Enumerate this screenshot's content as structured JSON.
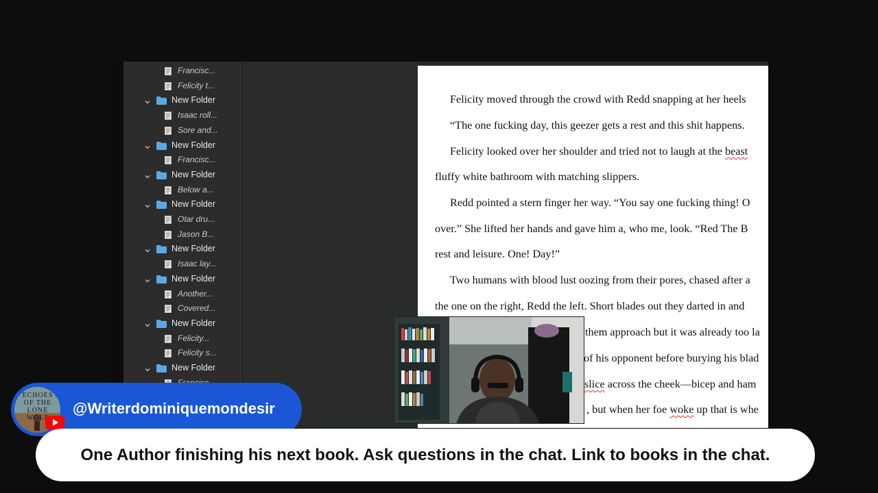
{
  "binder": {
    "items": [
      {
        "type": "doc",
        "label": "Francisc..."
      },
      {
        "type": "doc",
        "label": "Felicity t..."
      },
      {
        "type": "folder",
        "label": "New Folder"
      },
      {
        "type": "doc",
        "label": "Isaac roll..."
      },
      {
        "type": "doc",
        "label": "Sore and..."
      },
      {
        "type": "folder",
        "label": "New Folder"
      },
      {
        "type": "doc",
        "label": "Francisc..."
      },
      {
        "type": "folder",
        "label": "New Folder"
      },
      {
        "type": "doc",
        "label": "Below a..."
      },
      {
        "type": "folder",
        "label": "New Folder"
      },
      {
        "type": "doc",
        "label": "Otar dru..."
      },
      {
        "type": "doc",
        "label": "Jason B..."
      },
      {
        "type": "folder",
        "label": "New Folder"
      },
      {
        "type": "doc",
        "label": "Isaac lay..."
      },
      {
        "type": "folder",
        "label": "New Folder"
      },
      {
        "type": "doc",
        "label": "Another..."
      },
      {
        "type": "doc",
        "label": "Covered..."
      },
      {
        "type": "folder",
        "label": "New Folder"
      },
      {
        "type": "doc",
        "label": "Felicity..."
      },
      {
        "type": "doc",
        "label": "Felicity s..."
      },
      {
        "type": "folder",
        "label": "New Folder"
      },
      {
        "type": "doc",
        "label": "Francisc..."
      }
    ]
  },
  "document": {
    "lines": [
      "Felicity moved through the crowd with Redd snapping at her heels",
      "“The one fucking day, this geezer gets a rest and this shit happens. ",
      "Felicity looked over her shoulder and tried not to laugh at the beast",
      "fluffy white bathroom with matching slippers.",
      "Redd pointed a stern finger her way. “You say one fucking thing! O",
      "over.” She lifted her hands and gave him a, who me, look. “Red The B",
      "rest and leisure. One! Day!”",
      "Two humans with blood lust oozing from their pores, chased after a",
      "the one on the right, Redd the left. Short blades out they darted in and",
      "them approach but it was already too la",
      "of his opponent before burying his blad",
      "slice across the cheek—bicep and ham",
      ", but when her foe woke up that is whe"
    ]
  },
  "overlay": {
    "handle": "@Writerdominiquemondesir",
    "avatar_text": "ECHOES OF THE LONE WOLF",
    "ticker": "One Author finishing his next book. Ask questions in the chat. Link to books in the chat."
  },
  "colors": {
    "brand_blue": "#1a56d6",
    "folder_blue": "#5aa9e6",
    "youtube_red": "#ff0000"
  }
}
